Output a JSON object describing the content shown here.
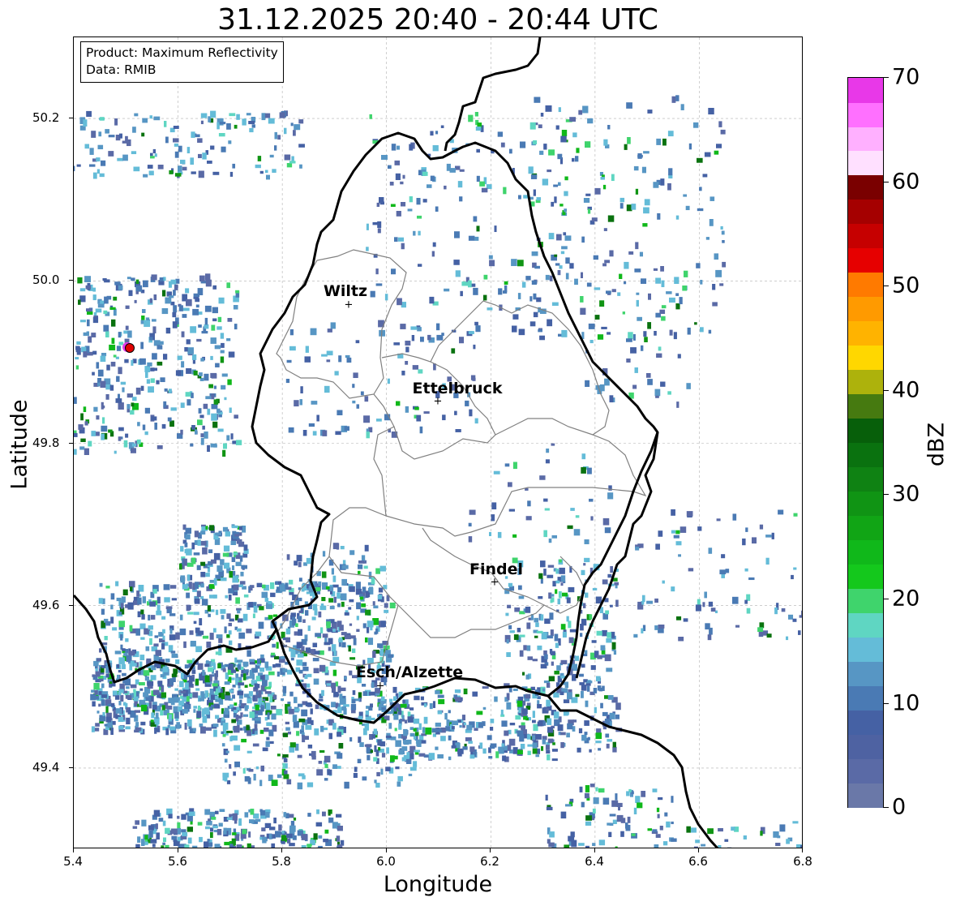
{
  "title": "31.12.2025 20:40 - 20:44 UTC",
  "info_box": {
    "line1": "Product: Maximum Reflectivity",
    "line2": "Data: RMIB"
  },
  "axes": {
    "x_label": "Longitude",
    "y_label": "Latitude",
    "x_ticks": [
      "5.4",
      "5.6",
      "5.8",
      "6.0",
      "6.2",
      "6.4",
      "6.6",
      "6.8"
    ],
    "y_ticks": [
      "50.2",
      "50.0",
      "49.8",
      "49.6",
      "49.4"
    ],
    "x_range": [
      5.4,
      6.8
    ],
    "y_range": [
      49.3,
      50.3
    ],
    "grid": true
  },
  "cities": [
    {
      "name": "Wiltz",
      "lon": 5.93,
      "lat": 49.97
    },
    {
      "name": "Ettelbruck",
      "lon": 6.1,
      "lat": 49.85
    },
    {
      "name": "Findel",
      "lon": 6.21,
      "lat": 49.63
    },
    {
      "name": "Esch/Alzette",
      "lon": 5.99,
      "lat": 49.5
    }
  ],
  "radar_site": {
    "lon": 5.505,
    "lat": 49.915,
    "color": "#e00000"
  },
  "colorbar": {
    "label": "dBZ",
    "ticks": [
      "0",
      "10",
      "20",
      "30",
      "40",
      "50",
      "60",
      "70"
    ],
    "min": 0,
    "max": 70,
    "colors": [
      "#6a78a8",
      "#5a6aa6",
      "#4e62a2",
      "#4561a4",
      "#4a7ab4",
      "#5796c4",
      "#64bcd8",
      "#5fd6c2",
      "#3fd46c",
      "#14c81c",
      "#10b81a",
      "#11a515",
      "#109414",
      "#0f8213",
      "#0a720f",
      "#075f0a",
      "#467a10",
      "#adb20c",
      "#ffd700",
      "#ffb300",
      "#ff9a00",
      "#ff7a00",
      "#e60000",
      "#c60000",
      "#a50000",
      "#7a0000",
      "#ffe0ff",
      "#ffb0ff",
      "#ff70ff",
      "#e838e8"
    ]
  },
  "colors": {
    "border_national": "#000000",
    "border_canton": "#808080",
    "grid": "#b0b0b0"
  }
}
